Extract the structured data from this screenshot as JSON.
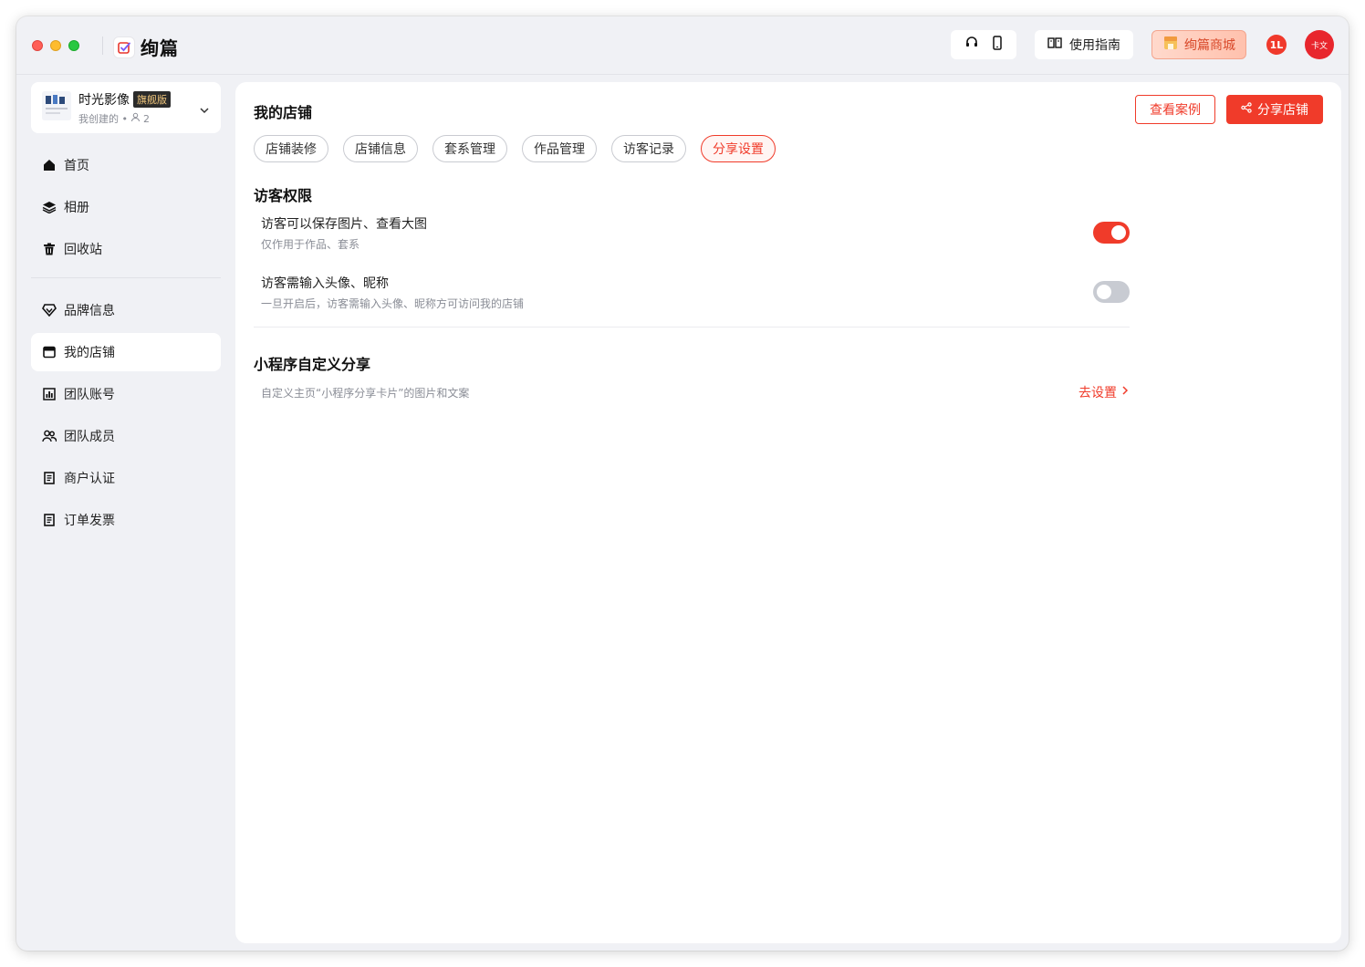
{
  "app": {
    "brand_name": "绚篇"
  },
  "header": {
    "guide_label": "使用指南",
    "mall_label": "绚篇商城",
    "badge_text": "1L",
    "avatar_text": "卡文"
  },
  "workspace": {
    "name": "时光影像",
    "tag": "旗舰版",
    "subtitle": "我创建的 •",
    "member_count": "2"
  },
  "sidebar": {
    "items": [
      {
        "label": "首页",
        "icon": "home-icon"
      },
      {
        "label": "相册",
        "icon": "layers-icon"
      },
      {
        "label": "回收站",
        "icon": "trash-icon"
      },
      {
        "label": "品牌信息",
        "icon": "diamond-icon"
      },
      {
        "label": "我的店铺",
        "icon": "store-icon",
        "active": true
      },
      {
        "label": "团队账号",
        "icon": "chart-icon"
      },
      {
        "label": "团队成员",
        "icon": "people-icon"
      },
      {
        "label": "商户认证",
        "icon": "doc-icon"
      },
      {
        "label": "订单发票",
        "icon": "invoice-icon"
      }
    ]
  },
  "main": {
    "title": "我的店铺",
    "view_cases_label": "查看案例",
    "share_store_label": "分享店铺",
    "tabs": [
      "店铺装修",
      "店铺信息",
      "套系管理",
      "作品管理",
      "访客记录",
      "分享设置"
    ],
    "active_tab": "分享设置",
    "visitor_section": {
      "title": "访客权限",
      "rows": [
        {
          "title": "访客可以保存图片、查看大图",
          "desc": "仅作用于作品、套系",
          "enabled": true
        },
        {
          "title": "访客需输入头像、昵称",
          "desc": "一旦开启后，访客需输入头像、昵称方可访问我的店铺",
          "enabled": false
        }
      ]
    },
    "mini_section": {
      "title": "小程序自定义分享",
      "desc": "自定义主页“小程序分享卡片”的图片和文案",
      "action_label": "去设置"
    }
  },
  "colors": {
    "accent": "#f03b2a",
    "toggle_off": "#c8cbd2",
    "background": "#f0f1f5"
  }
}
